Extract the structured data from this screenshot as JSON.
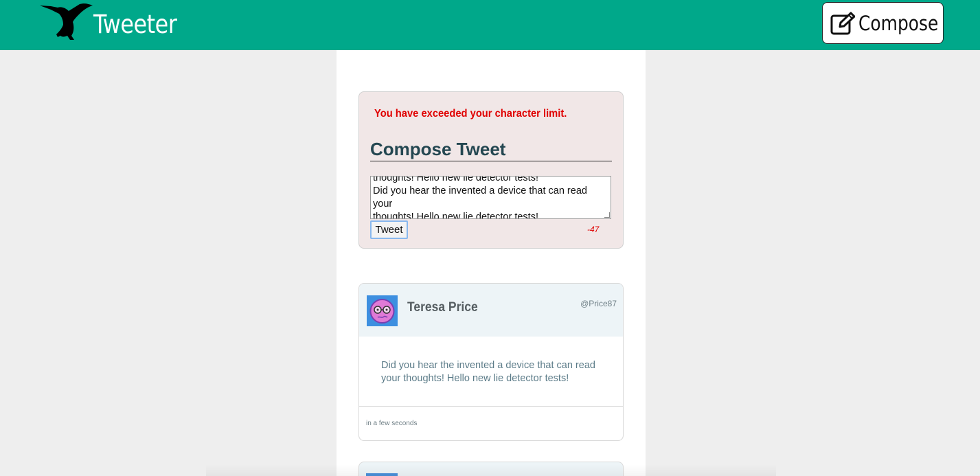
{
  "header": {
    "brand": "Tweeter",
    "logo_icon": "hummingbird-icon",
    "compose_label": "Compose",
    "compose_icon": "edit-icon",
    "bg_color": "#00a88a"
  },
  "compose": {
    "error": "You have exceeded your character limit.",
    "title": "Compose Tweet",
    "textarea_lines": [
      "thoughts! Hello new lie detector tests!",
      "Did you hear the invented a device that can read your",
      "thoughts! Hello new lie detector tests!"
    ],
    "tweet_button": "Tweet",
    "counter": "-47",
    "error_color": "#e00000"
  },
  "tweets": [
    {
      "name": "Teresa Price",
      "handle": "@Price87",
      "avatar_icon": "avatar-icon",
      "body_lines": [
        "Did you hear the invented a device that can read",
        "your thoughts! Hello new lie detector tests!"
      ],
      "timestamp": "in a few seconds"
    }
  ]
}
